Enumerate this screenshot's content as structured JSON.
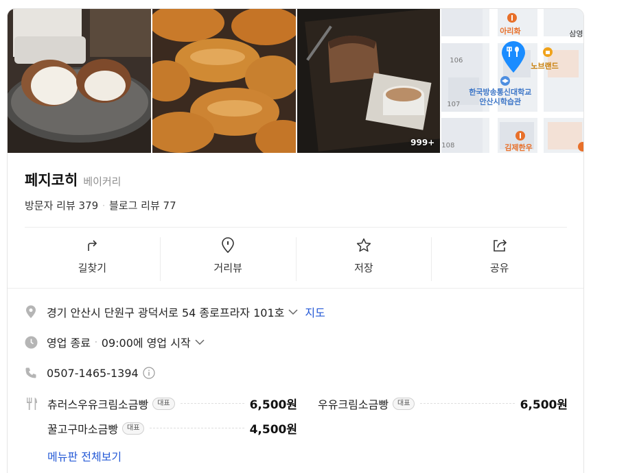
{
  "photos": {
    "count_badge": "999+"
  },
  "map": {
    "labels": {
      "ari": "아리화",
      "samyeong": "삼영",
      "nobrand": "노브랜드",
      "school_line1": "한국방송통신대학교",
      "school_line2": "안산시학습관",
      "kimje": "김제한우",
      "n106": "106",
      "n107": "107",
      "n108": "108"
    }
  },
  "place": {
    "name": "페지코히",
    "category": "베이커리",
    "visitor_reviews": "방문자 리뷰 379",
    "blog_reviews": "블로그 리뷰 77"
  },
  "actions": [
    {
      "label": "길찾기",
      "icon": "directions-icon"
    },
    {
      "label": "거리뷰",
      "icon": "street-view-icon"
    },
    {
      "label": "저장",
      "icon": "star-icon"
    },
    {
      "label": "공유",
      "icon": "share-icon"
    }
  ],
  "info": {
    "address": "경기 안산시 단원구 광덕서로 54 종로프라자 101호",
    "map_link": "지도",
    "status": "영업 종료",
    "next_open": "09:00에 영업 시작",
    "phone": "0507-1465-1394"
  },
  "menu": {
    "badge": "대표",
    "items": [
      {
        "name": "츄러스우유크림소금빵",
        "price": "6,500원"
      },
      {
        "name": "우유크림소금빵",
        "price": "6,500원"
      },
      {
        "name": "꿀고구마소금빵",
        "price": "4,500원"
      }
    ],
    "view_all": "메뉴판 전체보기"
  },
  "colors": {
    "accent_blue": "#2358d6",
    "map_pin": "#1a8cff",
    "poi_orange": "#e8702a"
  }
}
